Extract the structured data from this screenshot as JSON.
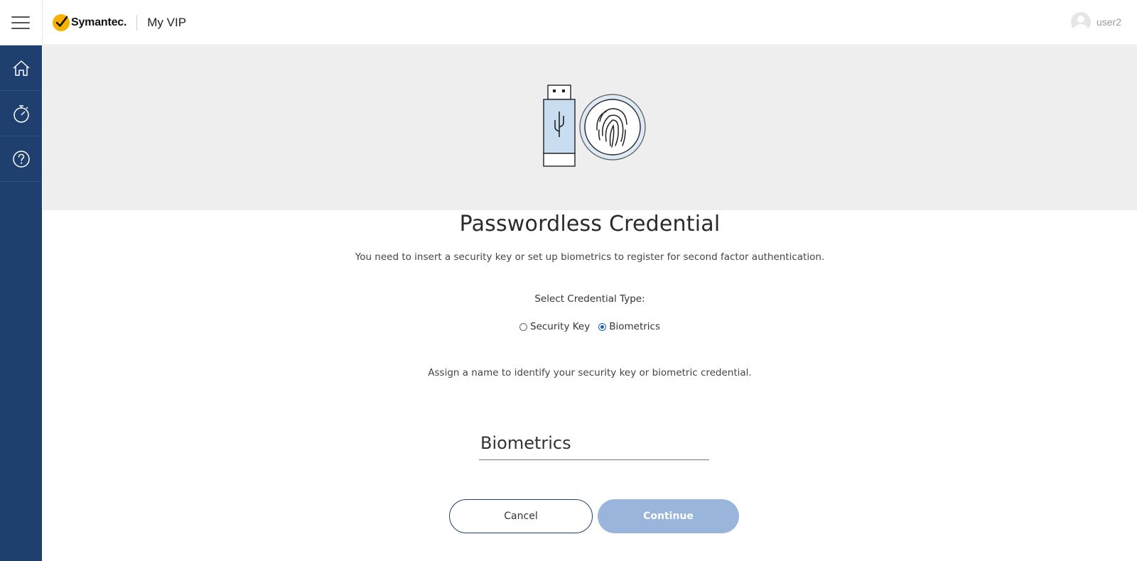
{
  "header": {
    "brand": "Symantec.",
    "app_title": "My VIP",
    "user_name": "user2"
  },
  "sidebar": {
    "items": [
      {
        "name": "home",
        "icon": "home-icon"
      },
      {
        "name": "activity",
        "icon": "stopwatch-icon"
      },
      {
        "name": "help",
        "icon": "help-icon"
      }
    ]
  },
  "main": {
    "title": "Passwordless Credential",
    "description": "You need to insert a security key or set up biometrics to register for second factor authentication.",
    "select_label": "Select Credential Type:",
    "options": [
      {
        "label": "Security Key",
        "checked": false
      },
      {
        "label": "Biometrics",
        "checked": true
      }
    ],
    "assign_description": "Assign a name to identify your security key or biometric credential.",
    "credential_name_value": "Biometrics",
    "cancel_label": "Cancel",
    "continue_label": "Continue"
  },
  "colors": {
    "sidebar": "#1f3f6e",
    "accent": "#1565c0",
    "continue_disabled": "#9ab5db",
    "hero_bg": "#eeeeee"
  }
}
